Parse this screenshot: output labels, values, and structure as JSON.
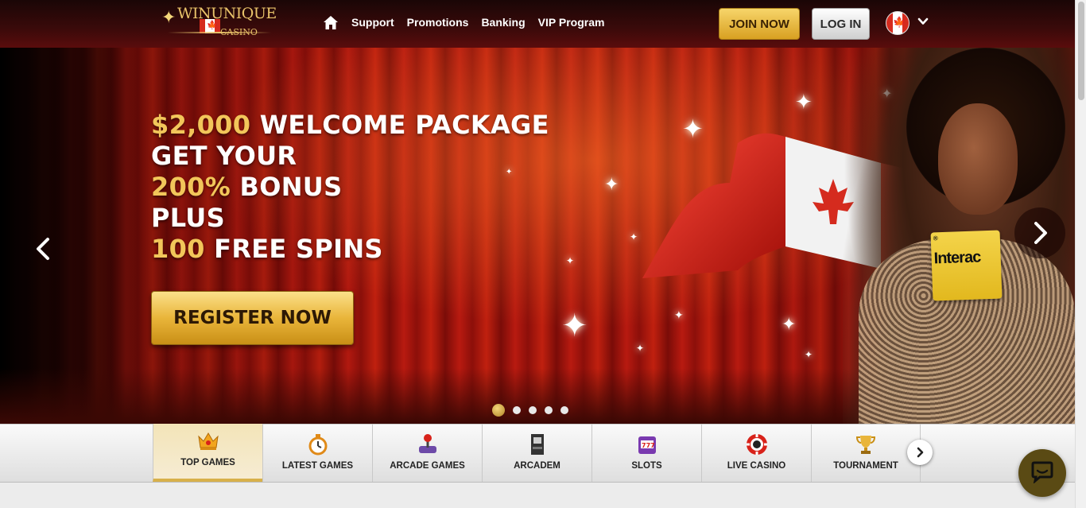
{
  "header": {
    "logo": {
      "brand": "WINUNIQUE",
      "sub": "CASINO"
    },
    "nav": [
      {
        "icon": "home-icon"
      },
      {
        "label": "Support"
      },
      {
        "label": "Promotions"
      },
      {
        "label": "Banking"
      },
      {
        "label": "VIP Program"
      }
    ],
    "join_label": "JOIN NOW",
    "login_label": "LOG IN",
    "language_flag": "canada-flag-icon"
  },
  "hero": {
    "line1_gold": "$2,000",
    "line1_white": "WELCOME PACKAGE",
    "line2": "GET YOUR",
    "line3_gold": "200%",
    "line3_white": "BONUS",
    "line4": "PLUS",
    "line5_gold": "100",
    "line5_white": "FREE SPINS",
    "cta_label": "REGISTER NOW",
    "card_text": "Interac",
    "card_mark": "®",
    "slide_count": 5,
    "active_slide": 1
  },
  "categories": [
    {
      "label": "TOP GAMES",
      "icon": "crown-icon",
      "active": true
    },
    {
      "label": "LATEST GAMES",
      "icon": "stopwatch-icon",
      "active": false
    },
    {
      "label": "ARCADE GAMES",
      "icon": "joystick-icon",
      "active": false
    },
    {
      "label": "ARCADEM",
      "icon": "arcade-cabinet-icon",
      "active": false
    },
    {
      "label": "SLOTS",
      "icon": "slot-machine-icon",
      "active": false
    },
    {
      "label": "LIVE CASINO",
      "icon": "casino-chip-icon",
      "active": false
    },
    {
      "label": "TOURNAMENT",
      "icon": "trophy-icon",
      "active": false
    }
  ],
  "colors": {
    "gold": "#f2c65a",
    "header_bg": "#3a0a0a",
    "hero_red": "#b81a10",
    "chat_bg": "#5a4a14"
  }
}
